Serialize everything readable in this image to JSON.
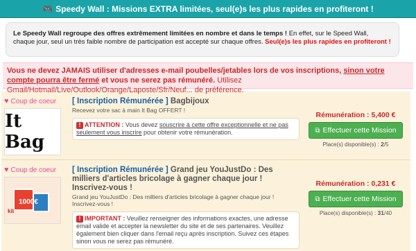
{
  "header": {
    "title": "Speedy Wall : Missions EXTRA limitées, seul(e)s les plus rapides en profiteront !",
    "icon": "gamepad-icon"
  },
  "intro": {
    "bold": "Le Speedy Wall regroupe des offres extrêmement limitées en nombre et dans le temps !",
    "text": " En effet, sur le Speed Wall, chaque jour, seul un très faible nombre de participation est accepté sur chaque offres. ",
    "red": "Seul(e)s les plus rapides en profiteront !"
  },
  "warning": {
    "part1": "Vous ne devez JAMAIS utiliser d'adresses e-mail poubelles/jetables lors de vos inscriptions, ",
    "underline": "sinon votre compte pourra être fermé",
    "part2": " et vous ne serez pas rémunéré.",
    "normal": " Utilisez Gmail/Hotmail/Live/Outlook/Orange/Laposte/Sfr/Neuf... de préférence."
  },
  "offers": [
    {
      "badge": "Coup de coeur",
      "tag": "[ Inscription Rémunérée ]",
      "name": "Bagbijoux",
      "desc": "Recevez votre sac à main It Bag OFFERT !",
      "alert_label": "ATTENTION :",
      "alert_text1": " Vous devez ",
      "alert_underline": "souscrire à cette offre exceptionnelle et ne pas seulement vous inscrire",
      "alert_text2": " pour obtenir votre rémunération.",
      "remuneration": "Rémunération : 5,400 €",
      "button": "Effectuer cette Mission",
      "places_label": "Place(s) disponible(s) :",
      "places_avail": "2",
      "places_total": "/5",
      "thumb_text": "It Bag"
    },
    {
      "badge": "Coup de coeur",
      "tag": "[ Inscription Rémunérée ]",
      "name": "Grand jeu YouJustDo : Des milliers d'articles bricolage à gagner chaque jour ! Inscrivez-vous !",
      "desc": "Grand jeu YouJustDo : Des milliers d'articles bricolage à gagner chaque jour ! Inscrivez-vous !",
      "alert_label": "IMPORTANT :",
      "alert_text1": " Veuillez renseigner des informations exactes, une adresse email valide et accepter la newsletter du site et de ses partenaires. Veuillez également bien cliquer dans l'email reçu après inscription. Suivez ces étapes sinon vous ne serez pas rémunéré.",
      "remuneration": "Rémunération : 0,231 €",
      "button": "Effectuer cette Mission",
      "places_label": "Place(s) disponible(s) :",
      "places_avail": "31",
      "places_total": "/40",
      "thumb_text": "1000€",
      "thumb_kit": "kit"
    }
  ]
}
